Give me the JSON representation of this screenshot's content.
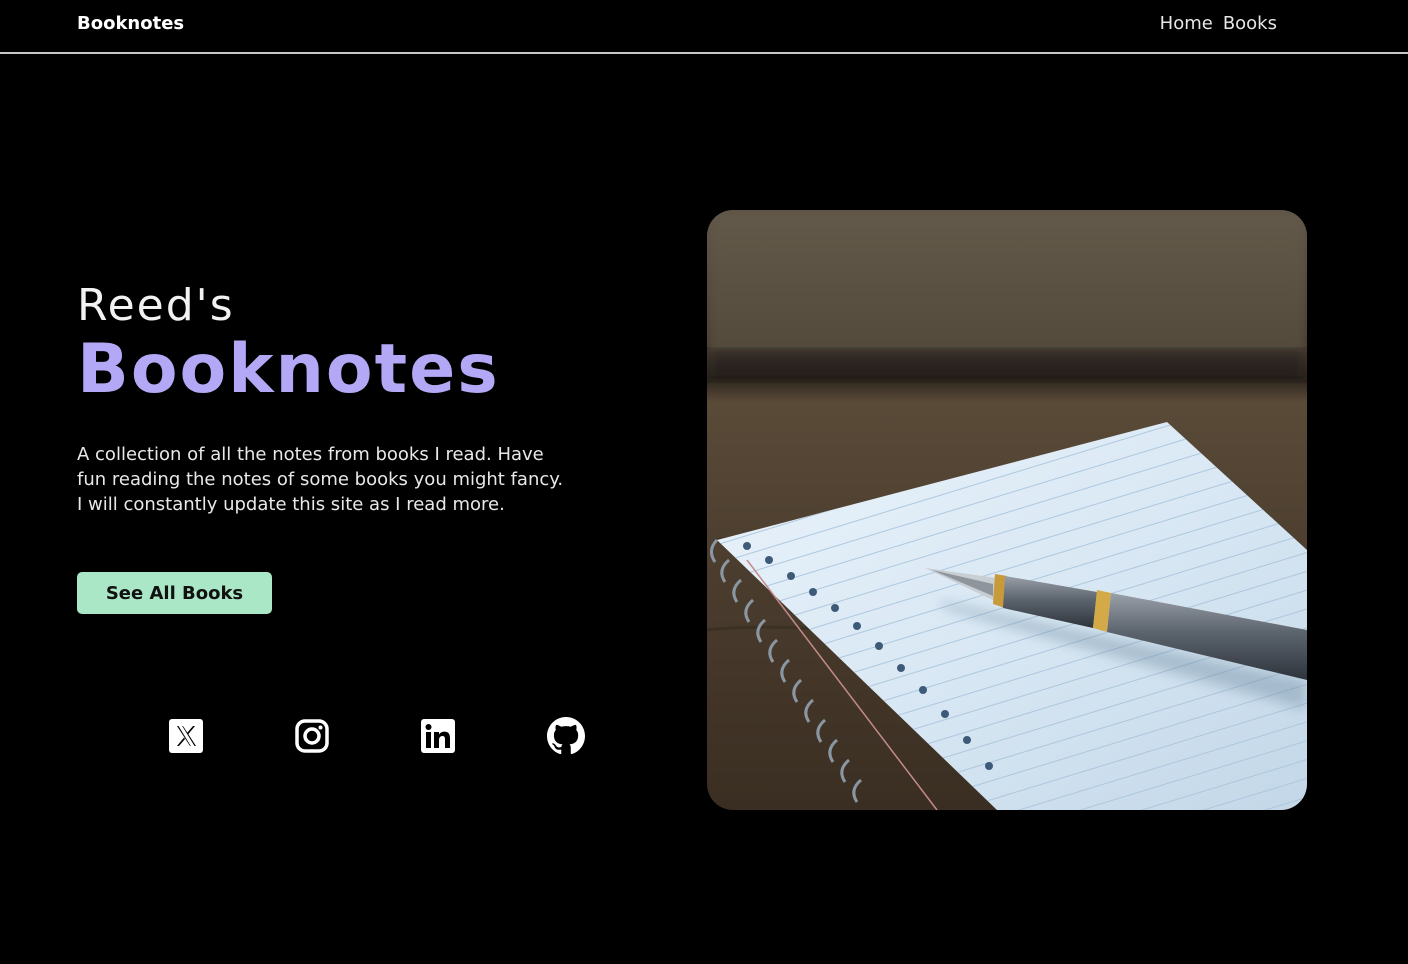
{
  "nav": {
    "brand": "Booknotes",
    "links": [
      "Home",
      "Books"
    ]
  },
  "hero": {
    "subtitle": "Reed's",
    "title": "Booknotes",
    "description": "A collection of all the notes from books I read. Have fun reading the notes of some books you might fancy. I will constantly update this site as I read more.",
    "cta_label": "See All Books"
  },
  "social": {
    "icons": [
      "x-icon",
      "instagram-icon",
      "linkedin-icon",
      "github-icon"
    ]
  },
  "colors": {
    "background": "#000000",
    "accent": "#b3a8f5",
    "button": "#a9e7c6"
  }
}
